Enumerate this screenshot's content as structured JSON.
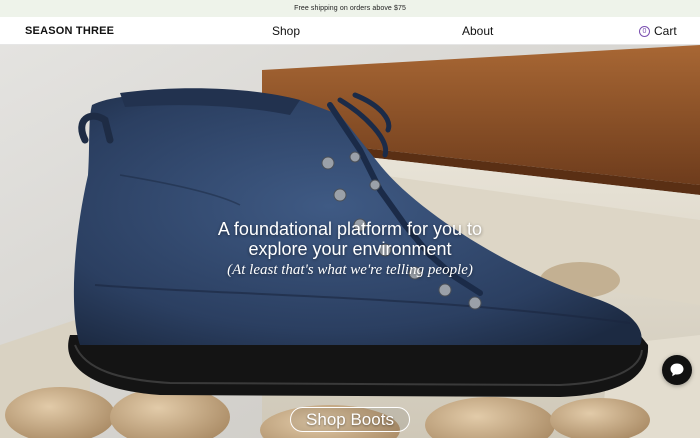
{
  "announcement": {
    "text": "Free shipping on orders above $75"
  },
  "header": {
    "logo": "SEASON THREE",
    "nav": {
      "shop": "Shop",
      "about": "About"
    },
    "cart": {
      "label": "Cart",
      "count": "0"
    }
  },
  "hero": {
    "headline_line1": "A foundational platform for you to",
    "headline_line2": "explore your environment",
    "tagline": "(At least that's what we're telling people)",
    "cta": "Shop Boots"
  },
  "colors": {
    "announcement_bg": "#eef3ea",
    "boot": "#2f4466",
    "sole": "#151515",
    "wood": "#8a4f26",
    "accent": "#7a4fb0"
  },
  "icons": {
    "chat": "chat-bubble-icon"
  }
}
